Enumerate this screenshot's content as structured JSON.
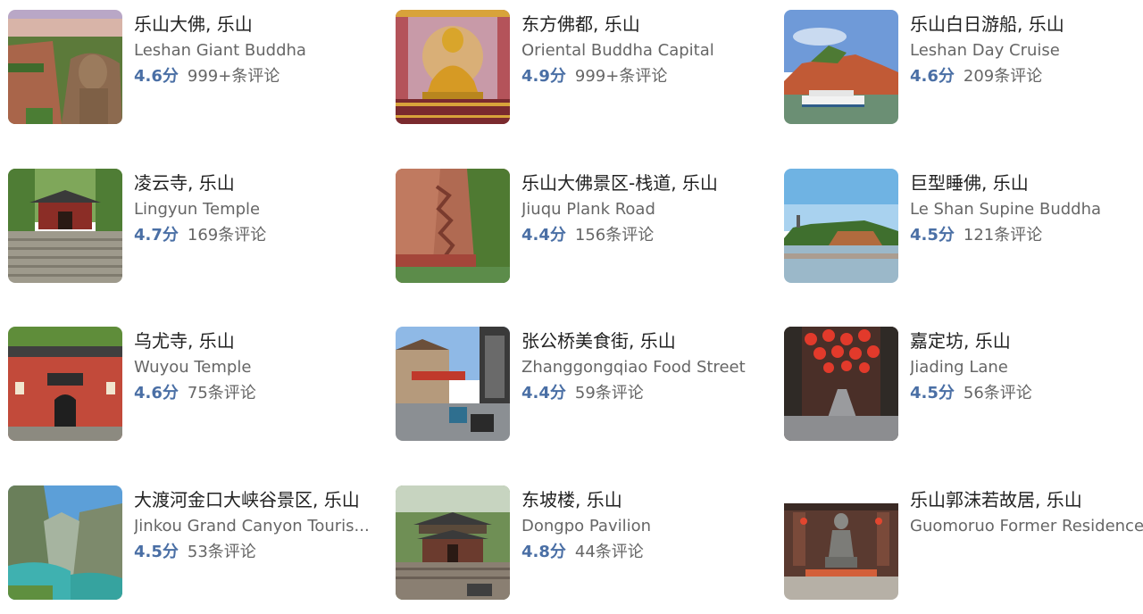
{
  "colors": {
    "score": "#4a6fa5",
    "title": "#222222",
    "subtitle": "#666666",
    "reviews": "#666666"
  },
  "attractions": [
    {
      "title": "乐山大佛, 乐山",
      "subtitle": "Leshan Giant Buddha",
      "score": "4.6分",
      "reviews": "999+条评论",
      "image": "giant-buddha-cliff"
    },
    {
      "title": "东方佛都, 乐山",
      "subtitle": "Oriental Buddha Capital",
      "score": "4.9分",
      "reviews": "999+条评论",
      "image": "golden-buddha-statue"
    },
    {
      "title": "乐山白日游船, 乐山",
      "subtitle": "Leshan Day Cruise",
      "score": "4.6分",
      "reviews": "209条评论",
      "image": "cruise-boat"
    },
    {
      "title": "凌云寺, 乐山",
      "subtitle": "Lingyun Temple",
      "score": "4.7分",
      "reviews": "169条评论",
      "image": "temple-steps"
    },
    {
      "title": "乐山大佛景区-栈道, 乐山",
      "subtitle": "Jiuqu Plank Road",
      "score": "4.4分",
      "reviews": "156条评论",
      "image": "cliff-plank-road"
    },
    {
      "title": "巨型睡佛, 乐山",
      "subtitle": "Le Shan Supine Buddha",
      "score": "4.5分",
      "reviews": "121条评论",
      "image": "supine-buddha-hills"
    },
    {
      "title": "乌尤寺, 乐山",
      "subtitle": "Wuyou Temple",
      "score": "4.6分",
      "reviews": "75条评论",
      "image": "red-temple-wall"
    },
    {
      "title": "张公桥美食街, 乐山",
      "subtitle": "Zhanggongqiao Food Street",
      "score": "4.4分",
      "reviews": "59条评论",
      "image": "food-street"
    },
    {
      "title": "嘉定坊, 乐山",
      "subtitle": "Jiading Lane",
      "score": "4.5分",
      "reviews": "56条评论",
      "image": "lantern-lane"
    },
    {
      "title": "大渡河金口大峡谷景区, 乐山",
      "subtitle": "Jinkou Grand Canyon Touris...",
      "score": "4.5分",
      "reviews": "53条评论",
      "image": "canyon-river"
    },
    {
      "title": "东坡楼, 乐山",
      "subtitle": "Dongpo Pavilion",
      "score": "4.8分",
      "reviews": "44条评论",
      "image": "pavilion-courtyard"
    },
    {
      "title": "乐山郭沫若故居, 乐山",
      "subtitle": "Guomoruo Former Residence",
      "score": "",
      "reviews": "",
      "image": "residence-statue"
    }
  ]
}
